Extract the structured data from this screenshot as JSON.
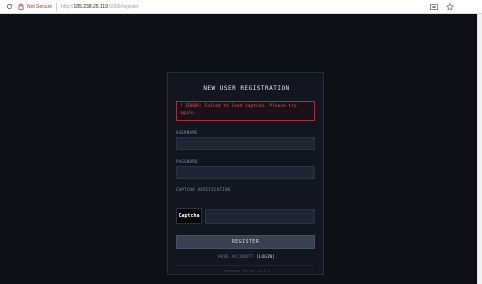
{
  "browser": {
    "security_label": "Not Secure",
    "url_prefix": "http://",
    "url_host": "185.238.25.119",
    "url_path": ":5000/register"
  },
  "form": {
    "title": "NEW USER REGISTRATION",
    "error_message": "! ERROR: Failed to load captcha. Please try again.",
    "username_label": "USERNAME",
    "username_value": "",
    "password_label": "PASSWORD",
    "password_value": "",
    "captcha_label": "CAPTCHA VERIFICATION",
    "captcha_image_text": "Captcha",
    "captcha_value": "",
    "register_label": "REGISTER",
    "have_account_text": "HAVE ACCOUNT?",
    "login_link": "[LOGIN]",
    "footer_text": "Feedback Portal v1.4.3"
  },
  "colors": {
    "background": "#0d1017",
    "card": "#111620",
    "error": "#e0505f",
    "button": "#384252"
  }
}
